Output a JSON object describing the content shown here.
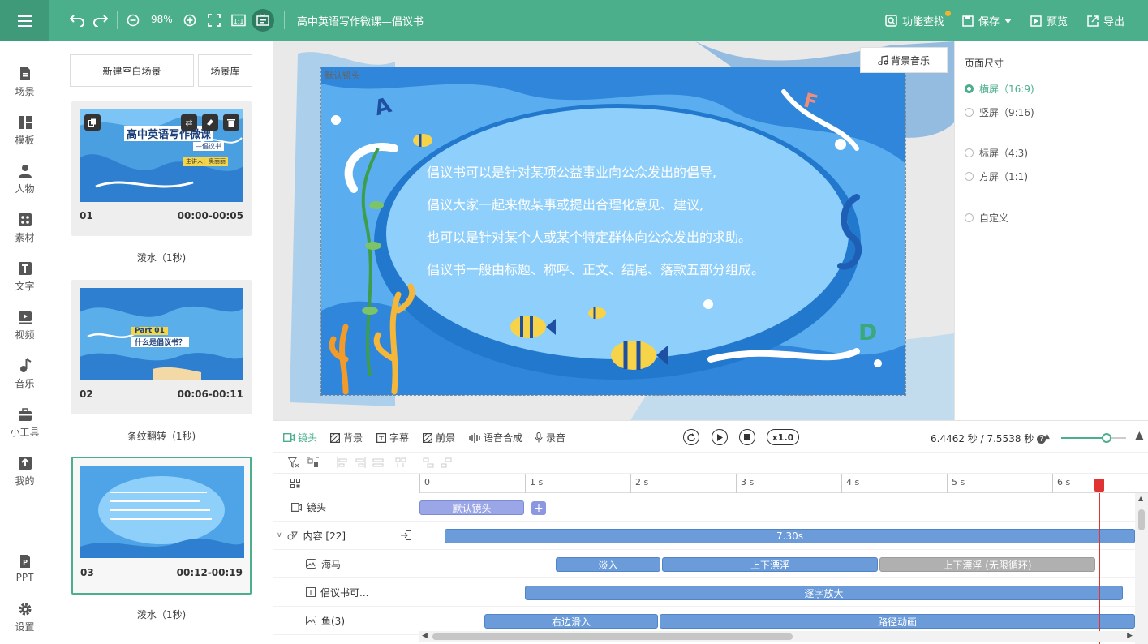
{
  "toolbar": {
    "zoom": "98%",
    "title": "高中英语写作微课—倡议书",
    "search": "功能查找",
    "save": "保存",
    "preview": "预览",
    "export": "导出"
  },
  "nav": [
    {
      "label": "场景",
      "icon": "scene-icon"
    },
    {
      "label": "模板",
      "icon": "template-icon"
    },
    {
      "label": "人物",
      "icon": "person-icon"
    },
    {
      "label": "素材",
      "icon": "material-icon"
    },
    {
      "label": "文字",
      "icon": "text-icon"
    },
    {
      "label": "视频",
      "icon": "video-icon"
    },
    {
      "label": "音乐",
      "icon": "music-icon"
    },
    {
      "label": "小工具",
      "icon": "toolbox-icon"
    },
    {
      "label": "我的",
      "icon": "upload-icon"
    },
    {
      "label": "PPT",
      "icon": "ppt-icon"
    },
    {
      "label": "设置",
      "icon": "gear-icon"
    }
  ],
  "scenes_panel": {
    "new_scene": "新建空白场景",
    "library": "场景库",
    "cards": [
      {
        "num": "01",
        "time": "00:00-00:05",
        "transition": "泼水（1秒)",
        "thumb_title": "高中英语写作微课",
        "thumb_sub": "—倡议书",
        "thumb_lecturer": "主讲人：奥丽丽"
      },
      {
        "num": "02",
        "time": "00:06-00:11",
        "transition": "条纹翻转（1秒)",
        "thumb_part": "Part 01",
        "thumb_question": "什么是倡议书？"
      },
      {
        "num": "03",
        "time": "00:12-00:19",
        "transition": "泼水（1秒)"
      }
    ]
  },
  "canvas": {
    "camera_label": "默认镜头",
    "bgm": "背景音乐",
    "lines": [
      "倡议书可以是针对某项公益事业向公众发出的倡导,",
      "倡议大家一起来做某事或提出合理化意见、建议,",
      "也可以是针对某个人或某个特定群体向公众发出的求助。",
      "倡议书一般由标题、称呼、正文、结尾、落款五部分组成。"
    ],
    "letters": [
      "A",
      "F",
      "D"
    ]
  },
  "props": {
    "heading": "页面尺寸",
    "options": [
      "横屏（16:9)",
      "竖屏（9:16)",
      "标屏（4:3)",
      "方屏（1:1)",
      "自定义"
    ],
    "selected": 0
  },
  "timeline": {
    "tabs": [
      "镜头",
      "背景",
      "字幕",
      "前景",
      "语音合成",
      "录音"
    ],
    "speed": "x1.0",
    "time": "6.4462 秒 / 7.5538 秒",
    "zoom_level": 0.7,
    "ruler": [
      "0",
      "1 s",
      "2 s",
      "3 s",
      "4 s",
      "5 s",
      "6 s"
    ],
    "tracks": [
      {
        "label": "镜头",
        "icon": "camera-icon"
      },
      {
        "label": "内容 [22]",
        "icon": "content-icon"
      },
      {
        "label": "海马",
        "icon": "image-icon"
      },
      {
        "label": "倡议书可...",
        "icon": "text-box-icon"
      },
      {
        "label": "鱼(3)",
        "icon": "image-icon"
      }
    ],
    "bars": {
      "camera": "默认镜头",
      "content": "7.30s",
      "seahorse": [
        "淡入",
        "上下漂浮",
        "上下漂浮 (无限循环)"
      ],
      "text": "逐字放大",
      "fish": [
        "右边滑入",
        "路径动画"
      ]
    },
    "playhead_seconds": 6.4462
  },
  "colors": {
    "accent": "#4caf8b",
    "bar": "#6b9bd8",
    "playhead": "#e03434"
  }
}
